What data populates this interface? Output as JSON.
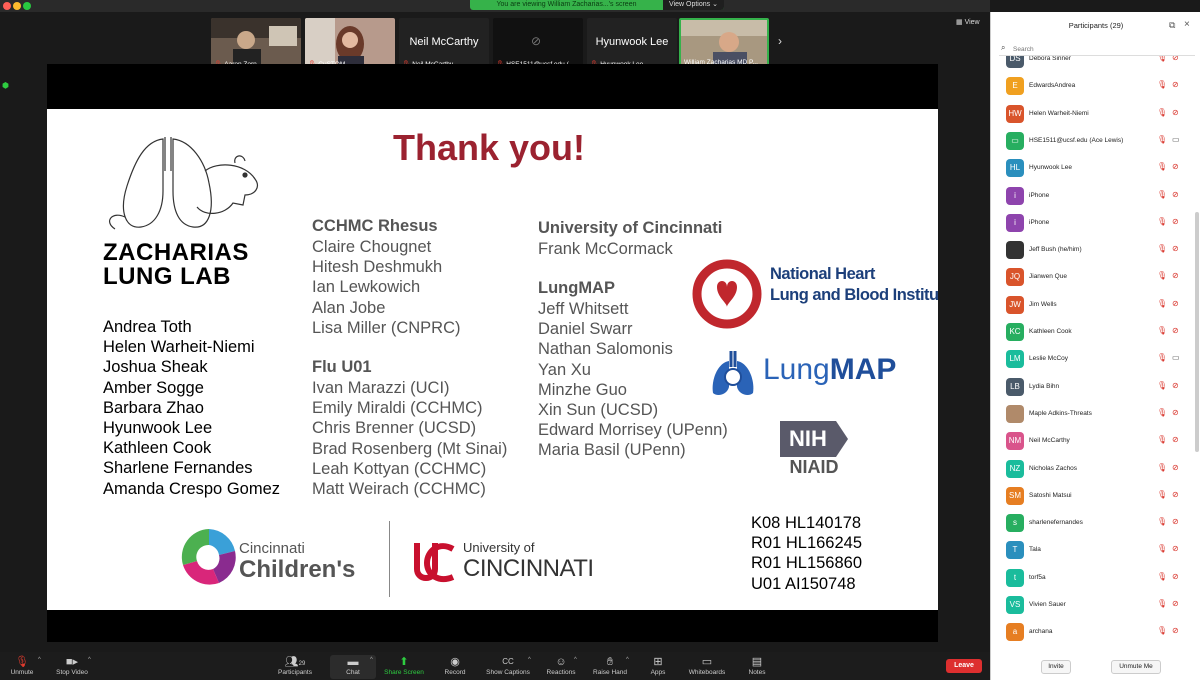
{
  "banner": {
    "text": "You are viewing William Zacharias...'s screen",
    "options": "View Options ⌄"
  },
  "view_button": "View",
  "thumbnails": [
    {
      "caption": "Aaron Zorn",
      "big": ""
    },
    {
      "caption": "CuSTOM",
      "big": ""
    },
    {
      "caption": "Neil McCarthy",
      "big": "Neil McCarthy"
    },
    {
      "caption": "HSE1511@ucsf.edu (...",
      "big": ""
    },
    {
      "caption": "Hyunwook Lee",
      "big": "Hyunwook Lee"
    },
    {
      "caption": "William Zacharias MD P...",
      "big": ""
    }
  ],
  "slide": {
    "title": "Thank you!",
    "lab_line1": "ZACHARIAS",
    "lab_line2": "LUNG LAB",
    "lab_members": [
      "Andrea Toth",
      "Helen Warheit-Niemi",
      "Joshua Sheak",
      "Amber Sogge",
      "Barbara Zhao",
      "Hyunwook Lee",
      "Kathleen Cook",
      "Sharlene Fernandes",
      "Amanda Crespo Gomez"
    ],
    "cchmc_head": "CCHMC Rhesus",
    "cchmc": [
      "Claire Chougnet",
      "Hitesh Deshmukh",
      "Ian Lewkowich",
      "Alan Jobe",
      "Lisa Miller (CNPRC)"
    ],
    "flu_head": "Flu U01",
    "flu": [
      "Ivan Marazzi (UCI)",
      "Emily Miraldi (CCHMC)",
      "Chris Brenner (UCSD)",
      "Brad Rosenberg (Mt Sinai)",
      "Leah Kottyan (CCHMC)",
      "Matt Weirach (CCHMC)"
    ],
    "uc_head": "University of Cincinnati",
    "uc": [
      "Frank McCormack"
    ],
    "lungmap_head": "LungMAP",
    "lungmap": [
      "Jeff Whitsett",
      "Daniel Swarr",
      "Nathan Salomonis",
      "Yan Xu",
      "Minzhe Guo",
      "Xin Sun (UCSD)",
      "Edward Morrisey (UPenn)",
      "Maria Basil (UPenn)"
    ],
    "nhlbi_line1": "National Heart",
    "nhlbi_line2": "Lung and Blood Institute",
    "lungmap_logo_a": "Lung",
    "lungmap_logo_b": "MAP",
    "nih": "NIH",
    "niaid": "NIAID",
    "cch_line1": "Cincinnati",
    "cch_line2": "Children's",
    "uc_logo_line1": "University of",
    "uc_logo_line2": "CINCINNATI",
    "grants": [
      "K08 HL140178",
      "R01 HL166245",
      "R01 HL156860",
      "U01 AI150748"
    ]
  },
  "panel": {
    "title": "Participants (29)",
    "search_placeholder": "Search",
    "participants": [
      {
        "initials": "DS",
        "name": "Debora Sinner",
        "color": "#4a5a6a",
        "video": true
      },
      {
        "initials": "E",
        "name": "EdwardsAndrea",
        "color": "#f0a020",
        "video": true
      },
      {
        "initials": "HW",
        "name": "Helen Warheit-Niemi",
        "color": "#d9542b",
        "video": true
      },
      {
        "initials": "▭",
        "name": "HSE1511@ucsf.edu (Ace Lewis)",
        "color": "#27ae60",
        "video": false
      },
      {
        "initials": "HL",
        "name": "Hyunwook Lee",
        "color": "#2a8fbd",
        "video": true
      },
      {
        "initials": "i",
        "name": "iPhone",
        "color": "#8e44ad",
        "video": true
      },
      {
        "initials": "i",
        "name": "iPhone",
        "color": "#8e44ad",
        "video": true
      },
      {
        "initials": "",
        "name": "Jeff Bush (he/him)",
        "color": "#333333",
        "video": true
      },
      {
        "initials": "JQ",
        "name": "Jianwen Que",
        "color": "#d9542b",
        "video": true
      },
      {
        "initials": "JW",
        "name": "Jim Wells",
        "color": "#d9542b",
        "video": true
      },
      {
        "initials": "KC",
        "name": "Kathleen Cook",
        "color": "#27ae60",
        "video": true
      },
      {
        "initials": "LM",
        "name": "Leslie McCoy",
        "color": "#1abc9c",
        "video": false
      },
      {
        "initials": "LB",
        "name": "Lydia Bihn",
        "color": "#4a5a6a",
        "video": true
      },
      {
        "initials": "",
        "name": "Maple Adkins-Threats",
        "color": "#b08a6a",
        "video": true
      },
      {
        "initials": "NM",
        "name": "Neil McCarthy",
        "color": "#d9548b",
        "video": true
      },
      {
        "initials": "NZ",
        "name": "Nicholas Zachos",
        "color": "#1abc9c",
        "video": true
      },
      {
        "initials": "SM",
        "name": "Satoshi Matsui",
        "color": "#e67e22",
        "video": true
      },
      {
        "initials": "s",
        "name": "sharlenefernandes",
        "color": "#27ae60",
        "video": true
      },
      {
        "initials": "T",
        "name": "Tala",
        "color": "#2a8fbd",
        "video": true
      },
      {
        "initials": "t",
        "name": "torf5a",
        "color": "#1abc9c",
        "video": true
      },
      {
        "initials": "VS",
        "name": "Vivien Sauer",
        "color": "#1abc9c",
        "video": true
      },
      {
        "initials": "a",
        "name": "archana",
        "color": "#e67e22",
        "video": true
      }
    ],
    "invite": "Invite",
    "unmute_me": "Unmute Me"
  },
  "toolbar": {
    "unmute": "Unmute",
    "stop_video": "Stop Video",
    "participants": "Participants",
    "participants_count": "29",
    "chat": "Chat",
    "share_screen": "Share Screen",
    "record": "Record",
    "show_captions": "Show Captions",
    "reactions": "Reactions",
    "raise_hand": "Raise Hand",
    "apps": "Apps",
    "whiteboards": "Whiteboards",
    "notes": "Notes",
    "leave": "Leave"
  }
}
